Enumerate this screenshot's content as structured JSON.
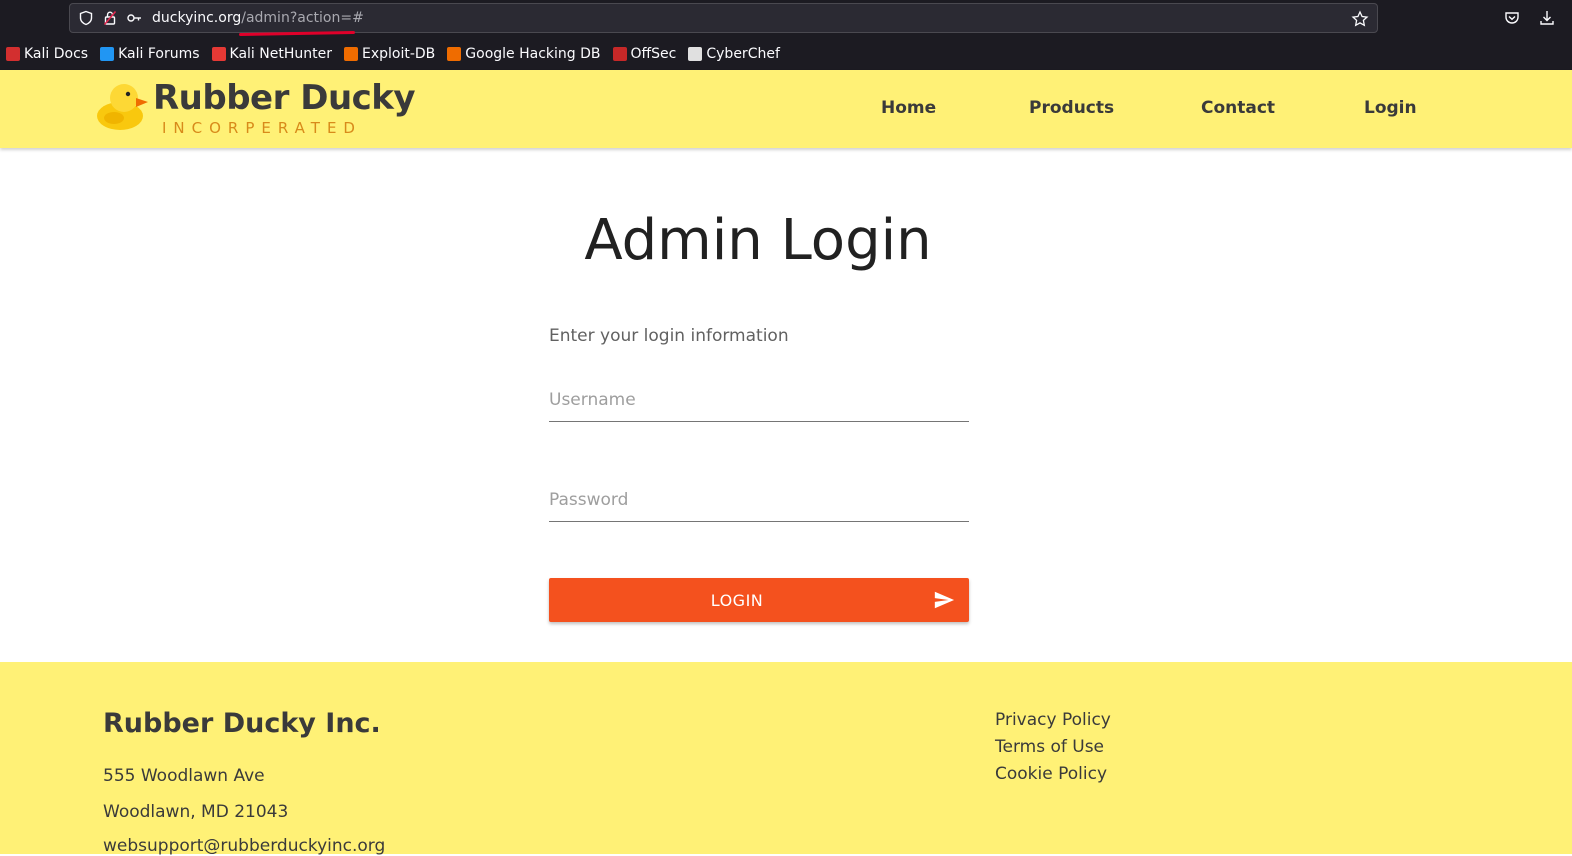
{
  "browser": {
    "url_host": "duckyinc.org",
    "url_path": "/admin?action=#",
    "bookmarks": [
      {
        "label": "Kali Docs",
        "color": "#d32f2f"
      },
      {
        "label": "Kali Forums",
        "color": "#2196f3"
      },
      {
        "label": "Kali NetHunter",
        "color": "#e53935"
      },
      {
        "label": "Exploit-DB",
        "color": "#ef6c00"
      },
      {
        "label": "Google Hacking DB",
        "color": "#ef6c00"
      },
      {
        "label": "OffSec",
        "color": "#c62828"
      },
      {
        "label": "CyberChef",
        "color": "#e0e0e0"
      }
    ]
  },
  "header": {
    "logo_title": "Rubber Ducky",
    "logo_subtitle": "INCORPERATED",
    "nav": [
      "Home",
      "Products",
      "Contact",
      "Login"
    ]
  },
  "main": {
    "heading": "Admin Login",
    "subtitle": "Enter your login information",
    "username_placeholder": "Username",
    "password_placeholder": "Password",
    "login_label": "LOGIN"
  },
  "footer": {
    "company": "Rubber Ducky Inc.",
    "address1": "555 Woodlawn Ave",
    "address2": "Woodlawn, MD 21043",
    "email": "websupport@rubberduckyinc.org",
    "links": [
      "Privacy Policy",
      "Terms of Use",
      "Cookie Policy"
    ]
  },
  "colors": {
    "brand_yellow": "#fff176",
    "accent_orange": "#f4511e"
  }
}
